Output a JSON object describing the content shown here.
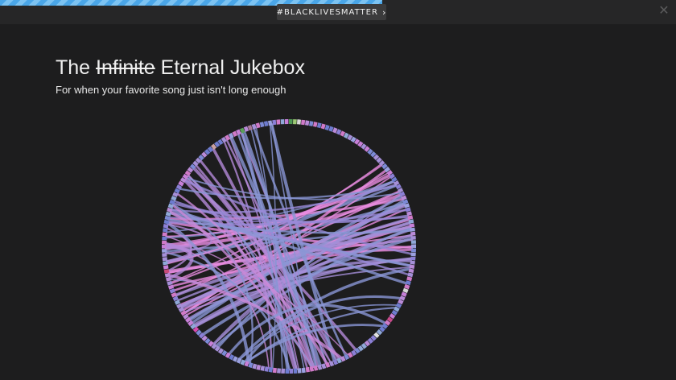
{
  "banner": {
    "label": "#BLACKLIVESMATTER",
    "chevron": "›"
  },
  "close": {
    "icon": "close-icon",
    "glyph": "✕"
  },
  "title": {
    "word1": "The",
    "struck": "Infinite",
    "rest": "Eternal Jukebox"
  },
  "subtitle": "For when your favorite song just isn't long enough",
  "playback_progress": 0.565,
  "colors": {
    "background": "#1d1d1e",
    "topbar": "#262627",
    "progress": "#4aa6e8",
    "edge_pink": "#e98ce0",
    "edge_lavender": "#a58fd8",
    "edge_blue": "#8a96d4"
  }
}
